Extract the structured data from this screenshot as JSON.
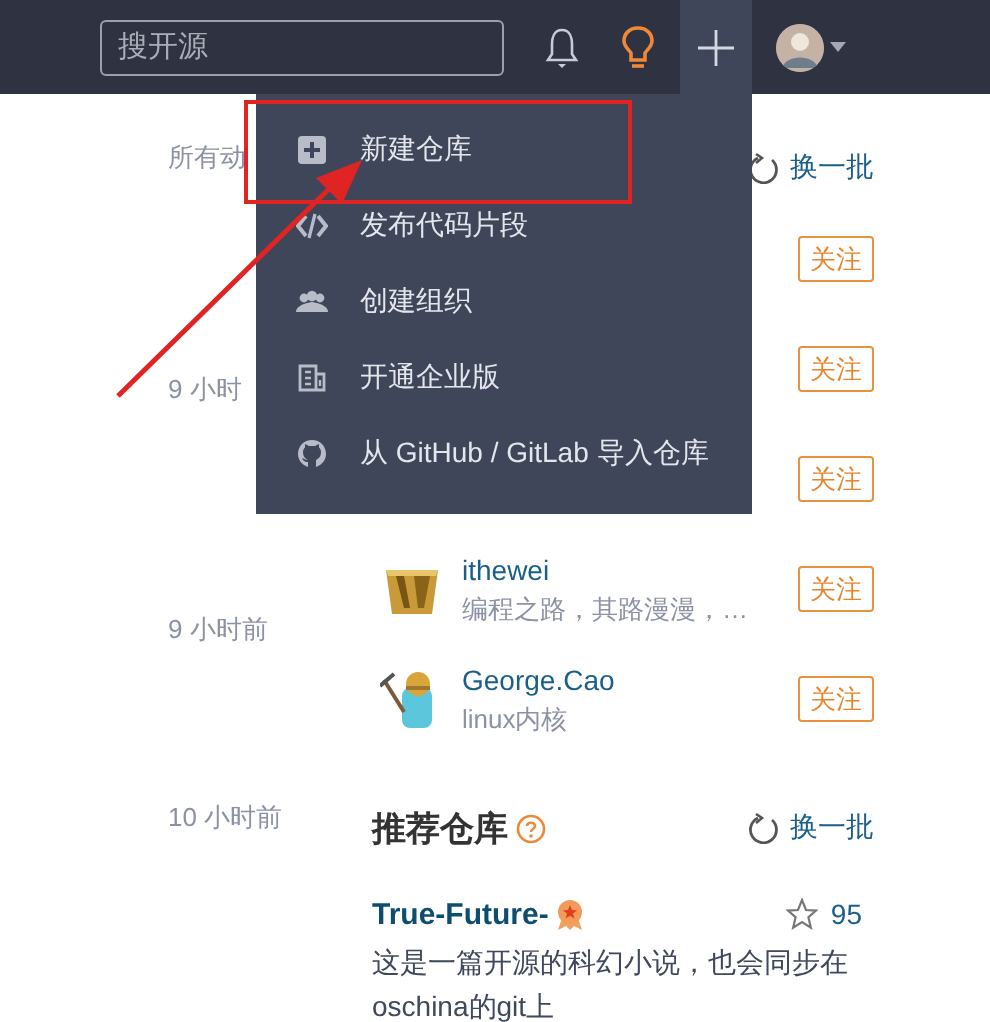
{
  "header": {
    "search": {
      "placeholder": "搜开源"
    },
    "create_button": {
      "expanded": true
    }
  },
  "create_menu": {
    "items": [
      {
        "label": "新建仓库"
      },
      {
        "label": "发布代码片段"
      },
      {
        "label": "创建组织"
      },
      {
        "label": "开通企业版"
      },
      {
        "label": "从 GitHub / GitLab 导入仓库"
      }
    ]
  },
  "timeline": [
    {
      "time": "所有动"
    },
    {
      "time": "9 小时"
    },
    {
      "time": "9 小时前"
    },
    {
      "time": "10 小时前"
    }
  ],
  "suggested_users": {
    "refresh": "换一批",
    "users": [
      {
        "follow": "关注"
      },
      {
        "follow": "关注"
      },
      {
        "follow": "关注"
      },
      {
        "name": "ithewei",
        "bio": "编程之路，其路漫漫，…",
        "follow": "关注"
      },
      {
        "name": "George.Cao",
        "bio": "linux内核",
        "follow": "关注"
      }
    ]
  },
  "recommended_repos": {
    "title": "推荐仓库",
    "refresh": "换一批",
    "repos": [
      {
        "name": "True-Future-",
        "star_count": "95",
        "description": "这是一篇开源的科幻小说，也会同步在oschina的git上"
      }
    ]
  },
  "annotations": {
    "highlight_box": true,
    "arrow": true
  }
}
